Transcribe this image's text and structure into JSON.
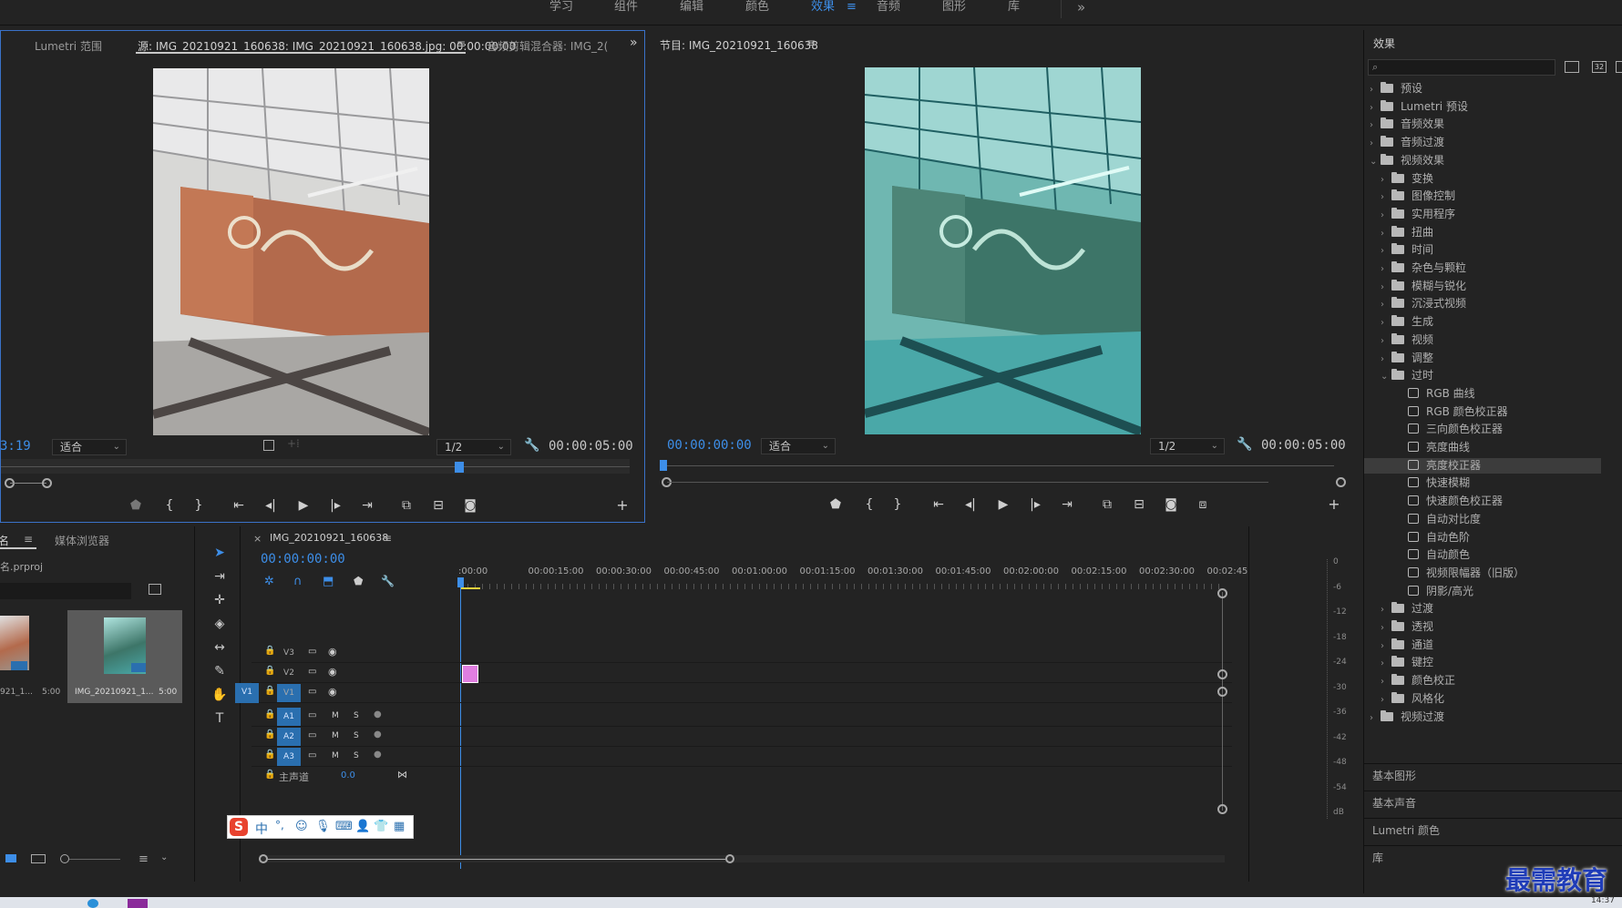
{
  "workspaces": {
    "items": [
      "学习",
      "组件",
      "编辑",
      "颜色",
      "效果",
      "音频",
      "图形",
      "库"
    ],
    "active": "效果",
    "more": "»"
  },
  "source_monitor": {
    "tab_lumetri": "Lumetri 范围",
    "tab_source": "源: IMG_20210921_160638: IMG_20210921_160638.jpg: 00:00:00:00",
    "tab_audio_mixer": "音频剪辑混合器: IMG_2(",
    "current_time": "3:19",
    "fit": "适合",
    "resolution": "1/2",
    "duration": "00:00:05:00"
  },
  "program_monitor": {
    "title": "节目: IMG_20210921_160638",
    "current_time": "00:00:00:00",
    "fit": "适合",
    "resolution": "1/2",
    "duration": "00:00:05:00"
  },
  "project_panel": {
    "tab_name": "名",
    "tab_browser": "媒体浏览器",
    "project_file": "名.prproj",
    "items": [
      {
        "name": "921_1...",
        "duration": "5:00"
      },
      {
        "name": "IMG_20210921_1...",
        "duration": "5:00"
      }
    ]
  },
  "timeline": {
    "sequence_name": "IMG_20210921_160638",
    "timecode": "00:00:00:00",
    "ruler": [
      ":00:00",
      "00:00:15:00",
      "00:00:30:00",
      "00:00:45:00",
      "00:01:00:00",
      "00:01:15:00",
      "00:01:30:00",
      "00:01:45:00",
      "00:02:00:00",
      "00:02:15:00",
      "00:02:30:00",
      "00:02:45:"
    ],
    "video_tracks": [
      "V3",
      "V2",
      "V1"
    ],
    "audio_tracks": [
      "A1",
      "A2",
      "A3"
    ],
    "source_v1": "V1",
    "mute": "M",
    "solo": "S",
    "master_label": "主声道",
    "master_value": "0.0",
    "meter_scale": [
      "0",
      "-6",
      "-12",
      "-18",
      "-24",
      "-30",
      "-36",
      "-42",
      "-48",
      "-54",
      "dB"
    ]
  },
  "effects_panel": {
    "title": "效果",
    "tree": [
      {
        "level": 0,
        "kind": "folder",
        "open": false,
        "label": "预设"
      },
      {
        "level": 0,
        "kind": "folder",
        "open": false,
        "label": "Lumetri 预设"
      },
      {
        "level": 0,
        "kind": "folder",
        "open": false,
        "label": "音频效果"
      },
      {
        "level": 0,
        "kind": "folder",
        "open": false,
        "label": "音频过渡"
      },
      {
        "level": 0,
        "kind": "folder",
        "open": true,
        "label": "视频效果"
      },
      {
        "level": 1,
        "kind": "folder",
        "open": false,
        "label": "变换"
      },
      {
        "level": 1,
        "kind": "folder",
        "open": false,
        "label": "图像控制"
      },
      {
        "level": 1,
        "kind": "folder",
        "open": false,
        "label": "实用程序"
      },
      {
        "level": 1,
        "kind": "folder",
        "open": false,
        "label": "扭曲"
      },
      {
        "level": 1,
        "kind": "folder",
        "open": false,
        "label": "时间"
      },
      {
        "level": 1,
        "kind": "folder",
        "open": false,
        "label": "杂色与颗粒"
      },
      {
        "level": 1,
        "kind": "folder",
        "open": false,
        "label": "模糊与锐化"
      },
      {
        "level": 1,
        "kind": "folder",
        "open": false,
        "label": "沉浸式视频"
      },
      {
        "level": 1,
        "kind": "folder",
        "open": false,
        "label": "生成"
      },
      {
        "level": 1,
        "kind": "folder",
        "open": false,
        "label": "视频"
      },
      {
        "level": 1,
        "kind": "folder",
        "open": false,
        "label": "调整"
      },
      {
        "level": 1,
        "kind": "folder",
        "open": true,
        "label": "过时"
      },
      {
        "level": 2,
        "kind": "effect",
        "label": "RGB 曲线"
      },
      {
        "level": 2,
        "kind": "effect",
        "label": "RGB 颜色校正器"
      },
      {
        "level": 2,
        "kind": "effect",
        "label": "三向颜色校正器"
      },
      {
        "level": 2,
        "kind": "effect",
        "label": "亮度曲线"
      },
      {
        "level": 2,
        "kind": "effect",
        "label": "亮度校正器",
        "selected": true
      },
      {
        "level": 2,
        "kind": "effect",
        "label": "快速模糊"
      },
      {
        "level": 2,
        "kind": "effect",
        "label": "快速颜色校正器"
      },
      {
        "level": 2,
        "kind": "effect",
        "label": "自动对比度"
      },
      {
        "level": 2,
        "kind": "effect",
        "label": "自动色阶"
      },
      {
        "level": 2,
        "kind": "effect",
        "label": "自动颜色"
      },
      {
        "level": 2,
        "kind": "effect",
        "label": "视频限幅器（旧版）"
      },
      {
        "level": 2,
        "kind": "effect",
        "label": "阴影/高光"
      },
      {
        "level": 1,
        "kind": "folder",
        "open": false,
        "label": "过渡"
      },
      {
        "level": 1,
        "kind": "folder",
        "open": false,
        "label": "透视"
      },
      {
        "level": 1,
        "kind": "folder",
        "open": false,
        "label": "通道"
      },
      {
        "level": 1,
        "kind": "folder",
        "open": false,
        "label": "键控"
      },
      {
        "level": 1,
        "kind": "folder",
        "open": false,
        "label": "颜色校正"
      },
      {
        "level": 1,
        "kind": "folder",
        "open": false,
        "label": "风格化"
      },
      {
        "level": 0,
        "kind": "folder",
        "open": false,
        "label": "视频过渡"
      }
    ],
    "sections": [
      "基本图形",
      "基本声音",
      "Lumetri 颜色",
      "库"
    ]
  },
  "watermark": "最需教育",
  "clock": "14:37",
  "colors": {
    "accent": "#3d8ee8",
    "panel_bg": "#232323",
    "clip_pink": "#e07ee0",
    "playhead": "#3d8ee8"
  }
}
